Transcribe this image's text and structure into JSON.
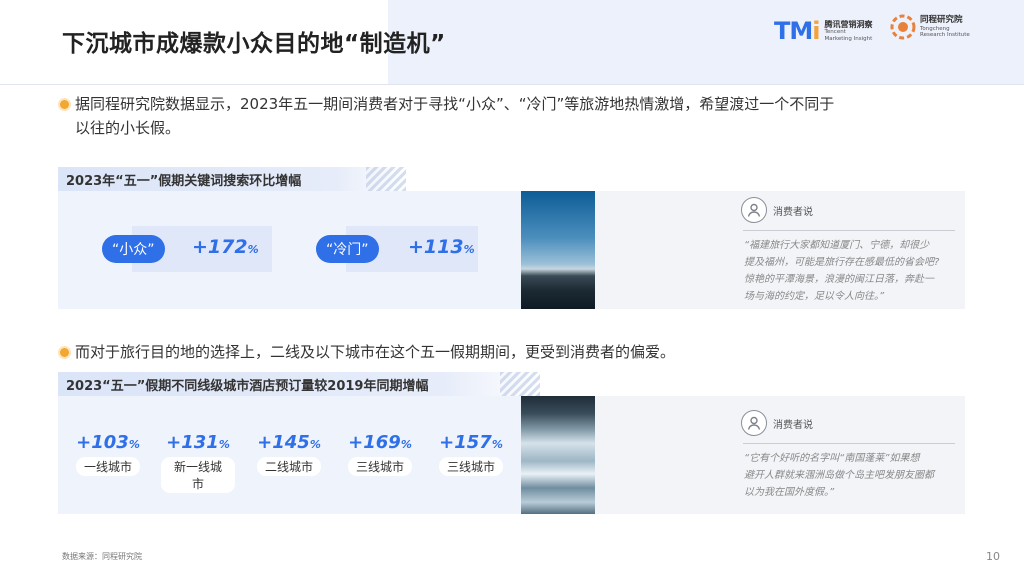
{
  "title": "下沉城市成爆款小众目的地“制造机”",
  "logos": {
    "tmi": {
      "mark": "TM",
      "dot": "i",
      "cn": "腾讯营销洞察",
      "en1": "Tencent",
      "en2": "Marketing Insight"
    },
    "tongcheng": {
      "cn": "同程研究院",
      "en1": "Tongcheng",
      "en2": "Research Institute"
    }
  },
  "bullet1": {
    "line1": "据同程研究院数据显示，2023年五一期间消费者对于寻找“小众”、“冷门”等旅游地热情激增，希望渡过一个不同于",
    "line2": "以往的小长假。"
  },
  "section1": {
    "title": "2023年“五一”假期关键词搜索环比增幅",
    "keywords": [
      {
        "label": "“小众”",
        "value": "+172",
        "unit": "%"
      },
      {
        "label": "“冷门”",
        "value": "+113",
        "unit": "%"
      }
    ],
    "quote": {
      "user_label": "消费者说",
      "lines": [
        "“福建旅行大家都知道厦门、宁德，却很少",
        "提及福州，可能是旅行存在感最低的省会吧?",
        "惊艳的平潭海景，浪漫的闽江日落，奔赴一",
        "场与海的约定，足以令人向往。”"
      ]
    }
  },
  "bullet2": {
    "text": "而对于旅行目的地的选择上，二线及以下城市在这个五一假期期间，更受到消费者的偏爱。"
  },
  "section2": {
    "title": "2023“五一”假期不同线级城市酒店预订量较2019年同期增幅",
    "stats": [
      {
        "value": "+103",
        "unit": "%",
        "label": "一线城市"
      },
      {
        "value": "+131",
        "unit": "%",
        "label": "新一线城市"
      },
      {
        "value": "+145",
        "unit": "%",
        "label": "二线城市"
      },
      {
        "value": "+169",
        "unit": "%",
        "label": "三线城市"
      },
      {
        "value": "+157",
        "unit": "%",
        "label": "三线城市"
      }
    ],
    "quote": {
      "user_label": "消费者说",
      "lines": [
        "“它有个好听的名字叫“南国蓬莱”如果想",
        "避开人群就来涠洲岛做个岛主吧发朋友圈都",
        "以为我在国外度假。”"
      ]
    }
  },
  "source": "数据来源：同程研究院",
  "page_number": "10",
  "colors": {
    "accent": "#2f6fe8",
    "bullet": "#f2a633",
    "panel": "#eef3fc"
  }
}
